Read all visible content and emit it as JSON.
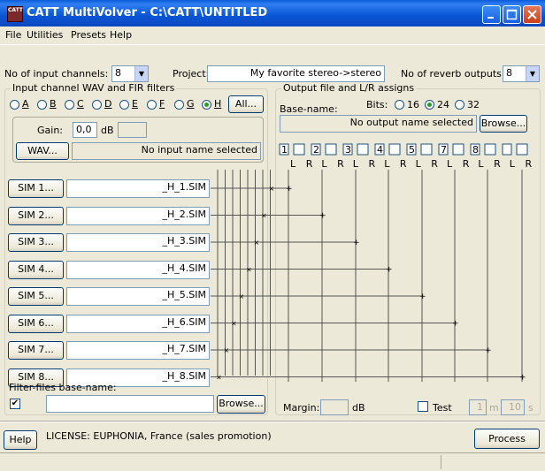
{
  "window": {
    "title": "CATT MultiVolver - C:\\CATT\\UNTITLED",
    "icon_text": "CATT"
  },
  "menu": [
    {
      "label": "File"
    },
    {
      "label": "Utilities"
    },
    {
      "label": "Presets"
    },
    {
      "label": "Help"
    }
  ],
  "top": {
    "input_channels_label": "No of input channels:",
    "input_channels_value": "8",
    "project_label": "Project:",
    "project_value": "My favorite stereo->stereo",
    "reverb_outputs_label": "No of reverb outputs:",
    "reverb_outputs_value": "8"
  },
  "input_group": {
    "title": "Input channel WAV and FIR filters",
    "channels": [
      "A",
      "B",
      "C",
      "D",
      "E",
      "F",
      "G",
      "H"
    ],
    "selected_channel": "H",
    "all_button": "All...",
    "gain_label": "Gain:",
    "gain_value": "0,0",
    "gain_unit": "dB",
    "wav_button": "WAV...",
    "wav_value": "No input name selected",
    "sim_buttons": [
      "SIM 1...",
      "SIM 2...",
      "SIM 3...",
      "SIM 4...",
      "SIM 5...",
      "SIM 6...",
      "SIM 7...",
      "SIM 8..."
    ],
    "sim_files": [
      "_H_1.SIM",
      "_H_2.SIM",
      "_H_3.SIM",
      "_H_4.SIM",
      "_H_5.SIM",
      "_H_6.SIM",
      "_H_7.SIM",
      "_H_8.SIM"
    ],
    "filter_base_label": "Filter-files base-name:",
    "filter_checked": true,
    "filter_value": "",
    "browse_button": "Browse..."
  },
  "output_group": {
    "title": "Output file and L/R assigns",
    "base_name_label": "Base-name:",
    "bits_label": "Bits:",
    "bits_options": [
      "16",
      "24",
      "32"
    ],
    "bits_selected": "24",
    "output_value": "No output name selected",
    "browse_button": "Browse...",
    "channels": [
      "1",
      "2",
      "3",
      "4",
      "5",
      "7",
      "8",
      ""
    ],
    "lr_labels": [
      "L",
      "R",
      "L",
      "R",
      "L",
      "R",
      "L",
      "R",
      "L",
      "R",
      "L",
      "R",
      "L",
      "R",
      "L",
      "R"
    ],
    "margin_label": "Margin:",
    "margin_value": "",
    "margin_unit": "dB",
    "test_label": "Test",
    "test_value_1": "1",
    "test_unit_1": "m",
    "test_value_2": "10",
    "test_unit_2": "s"
  },
  "footer": {
    "help_button": "Help",
    "license_text": "LICENSE: EUPHONIA, France (sales promotion)",
    "process_button": "Process"
  }
}
